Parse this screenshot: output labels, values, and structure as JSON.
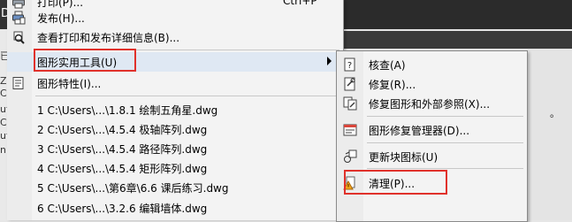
{
  "menu": {
    "items": [
      {
        "label": "打印(P)...",
        "shortcut": "Ctrl+P",
        "icon": "print-icon"
      },
      {
        "label": "发布(H)...",
        "icon": "publish-icon"
      },
      {
        "label": "查看打印和发布详细信息(B)...",
        "icon": "view-details-icon"
      },
      {
        "label": "图形实用工具(U)",
        "icon": ""
      },
      {
        "label": "图形特性(I)...",
        "icon": "drawing-properties-icon"
      },
      {
        "label": "1 C:\\Users\\...\\1.8.1 绘制五角星.dwg"
      },
      {
        "label": "2 C:\\Users\\...\\4.5.4 极轴阵列.dwg"
      },
      {
        "label": "3 C:\\Users\\...\\4.5.4 路径阵列.dwg"
      },
      {
        "label": "4 C:\\Users\\...\\4.5.4 矩形阵列.dwg"
      },
      {
        "label": "5 C:\\Users\\...\\第6章\\6.6 课后练习.dwg"
      },
      {
        "label": "6 C:\\Users\\...\\3.2.6 编辑墙体.dwg"
      }
    ]
  },
  "submenu": {
    "items": [
      {
        "label": "核查(A)",
        "icon": "audit-icon"
      },
      {
        "label": "修复(R)...",
        "icon": "recover-icon"
      },
      {
        "label": "修复图形和外部参照(X)...",
        "icon": "recover-xref-icon"
      },
      {
        "label": "图形修复管理器(D)...",
        "icon": "recovery-manager-icon"
      },
      {
        "label": "更新块图标(U)",
        "icon": "update-block-icon"
      },
      {
        "label": "清理(P)...",
        "icon": "purge-icon"
      }
    ]
  },
  "background": {
    "corner_glyph": "D",
    "left_fragments": [
      "已",
      "Z",
      "C",
      "ut",
      "C",
      "ut",
      "n"
    ],
    "right_mark": "。"
  }
}
